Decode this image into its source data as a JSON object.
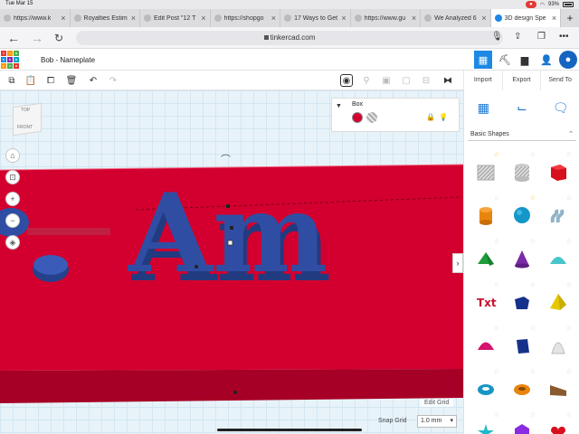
{
  "status": {
    "time": "Tue Mar 15",
    "battery": "93%"
  },
  "tabs": [
    {
      "label": "https://www.k"
    },
    {
      "label": "Royalties Estim"
    },
    {
      "label": "Edit Post \"12 T"
    },
    {
      "label": "https://shopgo"
    },
    {
      "label": "17 Ways to Get"
    },
    {
      "label": "https://www.gu"
    },
    {
      "label": "We Analyzed 6"
    },
    {
      "label": "3D design Spe",
      "active": true
    }
  ],
  "browser": {
    "url": "tinkercad.com"
  },
  "app": {
    "logo_letters": [
      "T",
      "I",
      "N",
      "K",
      "E",
      "R",
      "C",
      "A",
      "D"
    ],
    "doc_title": "Bob - Nameplate",
    "import_label": "Import",
    "export_label": "Export",
    "sendto_label": "Send To"
  },
  "viewcube": {
    "top": "TOP",
    "front": "FRONT"
  },
  "inspector": {
    "title": "Box"
  },
  "workplane": {
    "text": "Am",
    "edit_grid": "Edit Grid",
    "snap_grid_label": "Snap Grid",
    "snap_grid_value": "1.0 mm"
  },
  "library": {
    "selected": "Basic Shapes",
    "shapes": [
      {
        "name": "box-hole",
        "starred": true
      },
      {
        "name": "cylinder-hole",
        "starred": false
      },
      {
        "name": "box",
        "starred": false
      },
      {
        "name": "cylinder",
        "starred": false
      },
      {
        "name": "sphere",
        "starred": true
      },
      {
        "name": "scribble",
        "starred": false
      },
      {
        "name": "roof",
        "starred": false
      },
      {
        "name": "cone",
        "starred": false
      },
      {
        "name": "round-roof",
        "starred": false
      },
      {
        "name": "text",
        "starred": false
      },
      {
        "name": "shape-generator",
        "starred": false
      },
      {
        "name": "pyramid",
        "starred": false
      },
      {
        "name": "half-sphere",
        "starred": false
      },
      {
        "name": "polygon",
        "starred": false
      },
      {
        "name": "paraboloid",
        "starred": false
      },
      {
        "name": "torus",
        "starred": false
      },
      {
        "name": "tube",
        "starred": false
      },
      {
        "name": "wedge",
        "starred": false
      },
      {
        "name": "star",
        "starred": false
      },
      {
        "name": "icosahedron",
        "starred": false
      },
      {
        "name": "heart",
        "starred": false
      }
    ]
  },
  "colors": {
    "accent": "#1e88e5",
    "nameplate": "#d3002f",
    "text": "#2f4ea3"
  }
}
